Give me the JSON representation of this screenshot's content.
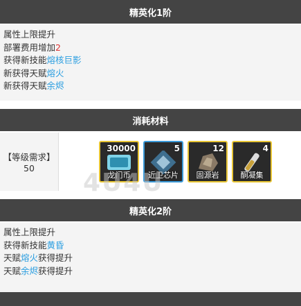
{
  "section1": {
    "title": "精英化1阶",
    "lines": [
      {
        "a": "属性上限提升",
        "b": "",
        "c": ""
      },
      {
        "a": "部署费用增加",
        "b": "2",
        "c": ""
      },
      {
        "a": "获得新技能",
        "b": "熔核巨影",
        "c": ""
      },
      {
        "a": "新获得天赋",
        "b": "熔火",
        "c": ""
      },
      {
        "a": "新获得天赋",
        "b": "余烬",
        "c": ""
      }
    ]
  },
  "materials": {
    "title": "消耗材料",
    "level_label": "【等级需求】",
    "level_value": "50",
    "items": [
      {
        "count": "30000",
        "name": "龙门币",
        "icon": "lmd-icon",
        "border": "#e8c534"
      },
      {
        "count": "5",
        "name": "近卫芯片",
        "icon": "chip-icon",
        "border": "#3a9ad9"
      },
      {
        "count": "12",
        "name": "固源岩",
        "icon": "orirock-icon",
        "border": "#e8c534"
      },
      {
        "count": "4",
        "name": "酮凝集",
        "icon": "ketone-icon",
        "border": "#e8c534"
      }
    ],
    "watermark": "4U4U"
  },
  "section2": {
    "title": "精英化2阶",
    "lines": [
      {
        "a": "属性上限提升",
        "b": "",
        "c": ""
      },
      {
        "a": "获得新技能",
        "b": "黄昏",
        "c": ""
      },
      {
        "a": "天赋",
        "b": "熔火",
        "c": "获得提升"
      },
      {
        "a": "天赋",
        "b": "余烬",
        "c": "获得提升"
      }
    ]
  }
}
